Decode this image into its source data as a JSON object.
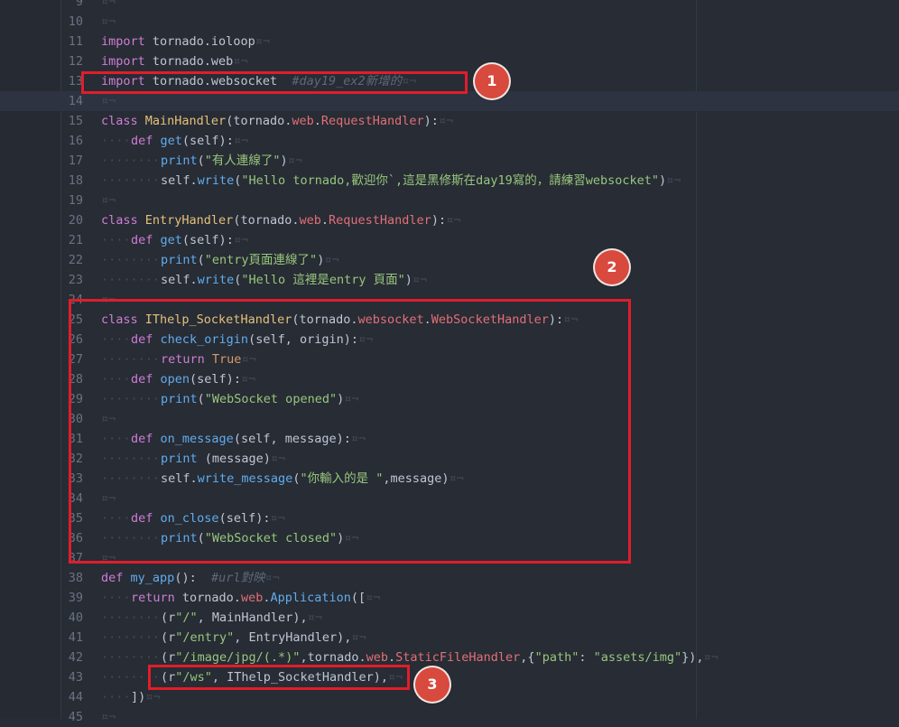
{
  "lines": [
    {
      "n": "9",
      "tokens": [
        {
          "t": "",
          "c": "txt"
        }
      ]
    },
    {
      "n": "10",
      "tokens": []
    },
    {
      "n": "11",
      "tokens": [
        {
          "t": "import",
          "c": "kw"
        },
        {
          "t": " tornado.ioloop",
          "c": "txt"
        }
      ]
    },
    {
      "n": "12",
      "tokens": [
        {
          "t": "import",
          "c": "kw"
        },
        {
          "t": " tornado.web",
          "c": "txt"
        }
      ]
    },
    {
      "n": "13",
      "tokens": [
        {
          "t": "import",
          "c": "kw"
        },
        {
          "t": " tornado.websocket  ",
          "c": "txt"
        },
        {
          "t": "#day19_ex2新增的",
          "c": "com"
        }
      ]
    },
    {
      "n": "14",
      "tokens": [],
      "current": true
    },
    {
      "n": "15",
      "tokens": [
        {
          "t": "class",
          "c": "kw"
        },
        {
          "t": " ",
          "c": "txt"
        },
        {
          "t": "MainHandler",
          "c": "cls"
        },
        {
          "t": "(tornado.",
          "c": "txt"
        },
        {
          "t": "web",
          "c": "mod"
        },
        {
          "t": ".",
          "c": "txt"
        },
        {
          "t": "RequestHandler",
          "c": "mod"
        },
        {
          "t": "):",
          "c": "txt"
        }
      ]
    },
    {
      "n": "16",
      "indent": 1,
      "tokens": [
        {
          "t": "def",
          "c": "kw"
        },
        {
          "t": " ",
          "c": "txt"
        },
        {
          "t": "get",
          "c": "fn"
        },
        {
          "t": "(self):",
          "c": "txt"
        }
      ]
    },
    {
      "n": "17",
      "indent": 2,
      "tokens": [
        {
          "t": "print",
          "c": "fn"
        },
        {
          "t": "(",
          "c": "txt"
        },
        {
          "t": "\"有人連線了\"",
          "c": "str"
        },
        {
          "t": ")",
          "c": "txt"
        }
      ]
    },
    {
      "n": "18",
      "indent": 2,
      "tokens": [
        {
          "t": "self.",
          "c": "txt"
        },
        {
          "t": "write",
          "c": "fn"
        },
        {
          "t": "(",
          "c": "txt"
        },
        {
          "t": "\"Hello tornado,歡迎你`,這是黑修斯在day19寫的，請練習websocket\"",
          "c": "str"
        },
        {
          "t": ")",
          "c": "txt"
        }
      ]
    },
    {
      "n": "19",
      "tokens": []
    },
    {
      "n": "20",
      "tokens": [
        {
          "t": "class",
          "c": "kw"
        },
        {
          "t": " ",
          "c": "txt"
        },
        {
          "t": "EntryHandler",
          "c": "cls"
        },
        {
          "t": "(tornado.",
          "c": "txt"
        },
        {
          "t": "web",
          "c": "mod"
        },
        {
          "t": ".",
          "c": "txt"
        },
        {
          "t": "RequestHandler",
          "c": "mod"
        },
        {
          "t": "):",
          "c": "txt"
        }
      ]
    },
    {
      "n": "21",
      "indent": 1,
      "tokens": [
        {
          "t": "def",
          "c": "kw"
        },
        {
          "t": " ",
          "c": "txt"
        },
        {
          "t": "get",
          "c": "fn"
        },
        {
          "t": "(self):",
          "c": "txt"
        }
      ]
    },
    {
      "n": "22",
      "indent": 2,
      "tokens": [
        {
          "t": "print",
          "c": "fn"
        },
        {
          "t": "(",
          "c": "txt"
        },
        {
          "t": "\"entry頁面連線了\"",
          "c": "str"
        },
        {
          "t": ")",
          "c": "txt"
        }
      ]
    },
    {
      "n": "23",
      "indent": 2,
      "tokens": [
        {
          "t": "self.",
          "c": "txt"
        },
        {
          "t": "write",
          "c": "fn"
        },
        {
          "t": "(",
          "c": "txt"
        },
        {
          "t": "\"Hello 這裡是entry 頁面\"",
          "c": "str"
        },
        {
          "t": ")",
          "c": "txt"
        }
      ]
    },
    {
      "n": "24",
      "tokens": []
    },
    {
      "n": "25",
      "tokens": [
        {
          "t": "class",
          "c": "kw"
        },
        {
          "t": " ",
          "c": "txt"
        },
        {
          "t": "IThelp_SocketHandler",
          "c": "cls"
        },
        {
          "t": "(tornado.",
          "c": "txt"
        },
        {
          "t": "websocket",
          "c": "mod"
        },
        {
          "t": ".",
          "c": "txt"
        },
        {
          "t": "WebSocketHandler",
          "c": "mod"
        },
        {
          "t": "):",
          "c": "txt"
        }
      ]
    },
    {
      "n": "26",
      "indent": 1,
      "tokens": [
        {
          "t": "def",
          "c": "kw"
        },
        {
          "t": " ",
          "c": "txt"
        },
        {
          "t": "check_origin",
          "c": "fn"
        },
        {
          "t": "(self, origin):",
          "c": "txt"
        }
      ]
    },
    {
      "n": "27",
      "indent": 2,
      "tokens": [
        {
          "t": "return",
          "c": "kw"
        },
        {
          "t": " ",
          "c": "txt"
        },
        {
          "t": "True",
          "c": "bool"
        }
      ]
    },
    {
      "n": "28",
      "indent": 1,
      "tokens": [
        {
          "t": "def",
          "c": "kw"
        },
        {
          "t": " ",
          "c": "txt"
        },
        {
          "t": "open",
          "c": "fn"
        },
        {
          "t": "(self):",
          "c": "txt"
        }
      ]
    },
    {
      "n": "29",
      "indent": 2,
      "tokens": [
        {
          "t": "print",
          "c": "fn"
        },
        {
          "t": "(",
          "c": "txt"
        },
        {
          "t": "\"WebSocket opened\"",
          "c": "str"
        },
        {
          "t": ")",
          "c": "txt"
        }
      ]
    },
    {
      "n": "30",
      "tokens": []
    },
    {
      "n": "31",
      "indent": 1,
      "tokens": [
        {
          "t": "def",
          "c": "kw"
        },
        {
          "t": " ",
          "c": "txt"
        },
        {
          "t": "on_message",
          "c": "fn"
        },
        {
          "t": "(self, message):",
          "c": "txt"
        }
      ]
    },
    {
      "n": "32",
      "indent": 2,
      "tokens": [
        {
          "t": "print",
          "c": "fn"
        },
        {
          "t": " (message)",
          "c": "txt"
        }
      ]
    },
    {
      "n": "33",
      "indent": 2,
      "tokens": [
        {
          "t": "self.",
          "c": "txt"
        },
        {
          "t": "write_message",
          "c": "fn"
        },
        {
          "t": "(",
          "c": "txt"
        },
        {
          "t": "\"你輸入的是 \"",
          "c": "str"
        },
        {
          "t": ",message)",
          "c": "txt"
        }
      ]
    },
    {
      "n": "34",
      "tokens": []
    },
    {
      "n": "35",
      "indent": 1,
      "tokens": [
        {
          "t": "def",
          "c": "kw"
        },
        {
          "t": " ",
          "c": "txt"
        },
        {
          "t": "on_close",
          "c": "fn"
        },
        {
          "t": "(self):",
          "c": "txt"
        }
      ]
    },
    {
      "n": "36",
      "indent": 2,
      "tokens": [
        {
          "t": "print",
          "c": "fn"
        },
        {
          "t": "(",
          "c": "txt"
        },
        {
          "t": "\"WebSocket closed\"",
          "c": "str"
        },
        {
          "t": ")",
          "c": "txt"
        }
      ]
    },
    {
      "n": "37",
      "tokens": []
    },
    {
      "n": "38",
      "tokens": [
        {
          "t": "def",
          "c": "kw"
        },
        {
          "t": " ",
          "c": "txt"
        },
        {
          "t": "my_app",
          "c": "fn"
        },
        {
          "t": "():  ",
          "c": "txt"
        },
        {
          "t": "#url對映",
          "c": "com"
        }
      ]
    },
    {
      "n": "39",
      "indent": 1,
      "tokens": [
        {
          "t": "return",
          "c": "kw"
        },
        {
          "t": " tornado.",
          "c": "txt"
        },
        {
          "t": "web",
          "c": "mod"
        },
        {
          "t": ".",
          "c": "txt"
        },
        {
          "t": "Application",
          "c": "fn"
        },
        {
          "t": "([",
          "c": "txt"
        }
      ]
    },
    {
      "n": "40",
      "indent": 2,
      "tokens": [
        {
          "t": "(r",
          "c": "txt"
        },
        {
          "t": "\"/\"",
          "c": "str"
        },
        {
          "t": ", MainHandler),",
          "c": "txt"
        }
      ]
    },
    {
      "n": "41",
      "indent": 2,
      "tokens": [
        {
          "t": "(r",
          "c": "txt"
        },
        {
          "t": "\"/entry\"",
          "c": "str"
        },
        {
          "t": ", EntryHandler),",
          "c": "txt"
        }
      ]
    },
    {
      "n": "42",
      "indent": 2,
      "tokens": [
        {
          "t": "(r",
          "c": "txt"
        },
        {
          "t": "\"/image/jpg/(.*)\"",
          "c": "str"
        },
        {
          "t": ",tornado.",
          "c": "txt"
        },
        {
          "t": "web",
          "c": "mod"
        },
        {
          "t": ".",
          "c": "txt"
        },
        {
          "t": "StaticFileHandler",
          "c": "mod"
        },
        {
          "t": ",{",
          "c": "txt"
        },
        {
          "t": "\"path\"",
          "c": "str"
        },
        {
          "t": ": ",
          "c": "txt"
        },
        {
          "t": "\"assets/img\"",
          "c": "str"
        },
        {
          "t": "}),",
          "c": "txt"
        }
      ]
    },
    {
      "n": "43",
      "indent": 2,
      "tokens": [
        {
          "t": "(r",
          "c": "txt"
        },
        {
          "t": "\"/ws\"",
          "c": "str"
        },
        {
          "t": ", IThelp_SocketHandler),",
          "c": "txt"
        }
      ]
    },
    {
      "n": "44",
      "indent": 1,
      "tokens": [
        {
          "t": "])",
          "c": "txt"
        }
      ]
    },
    {
      "n": "45",
      "tokens": []
    }
  ],
  "annotations": [
    {
      "label": "1"
    },
    {
      "label": "2"
    },
    {
      "label": "3"
    }
  ],
  "colors": {
    "highlight_box": "#e11d2a",
    "badge": "#d8493e"
  }
}
